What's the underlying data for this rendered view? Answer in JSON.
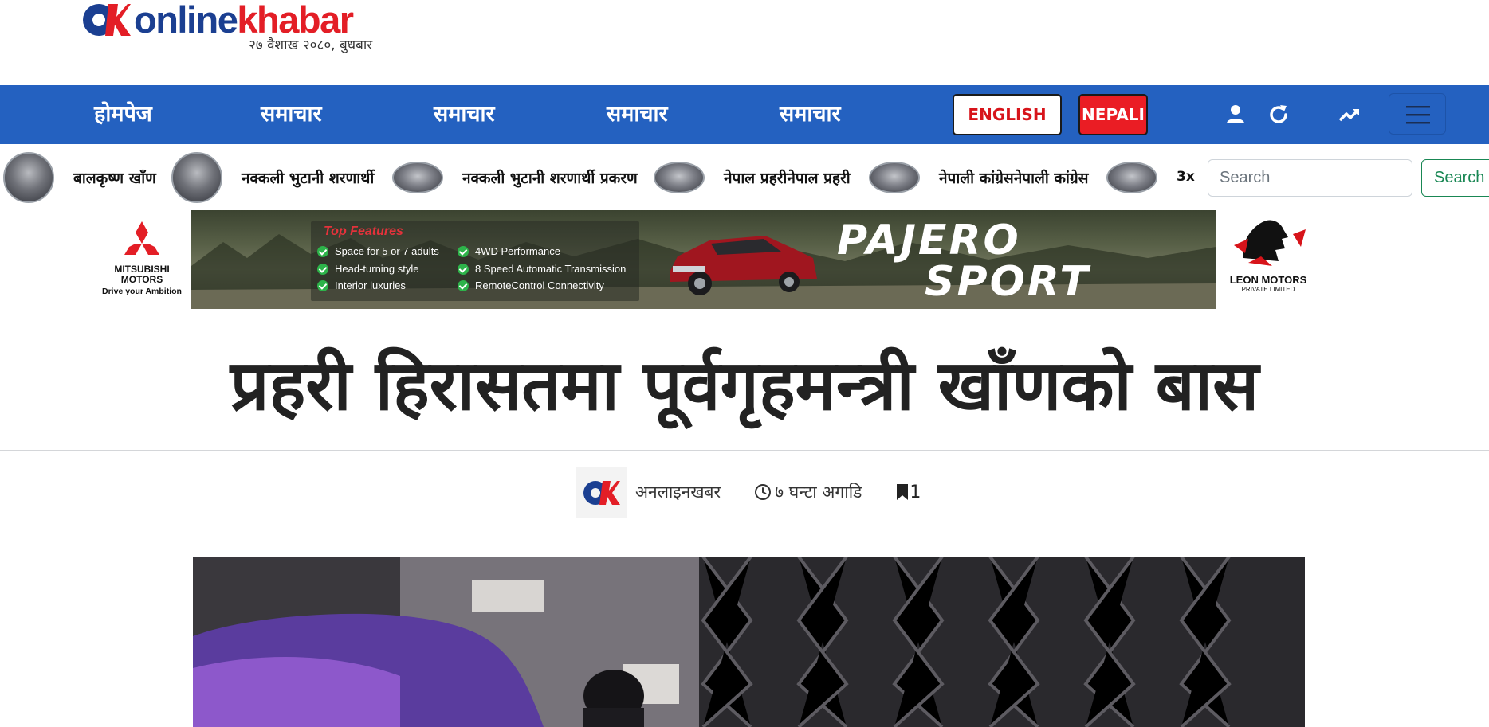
{
  "header": {
    "logo_part1": "online",
    "logo_part2": "khabar",
    "date": "२७ वैशाख २०८०, बुधबार"
  },
  "nav": {
    "items": [
      {
        "label": "होमपेज"
      },
      {
        "label": "समाचार"
      },
      {
        "label": "समाचार"
      },
      {
        "label": "समाचार"
      },
      {
        "label": "समाचार"
      }
    ],
    "english_label": "ENGLISH",
    "nepali_label": "NEPALI",
    "icons": [
      "user-icon",
      "refresh-icon",
      "trending-icon",
      "menu-icon"
    ]
  },
  "trending": {
    "items": [
      {
        "label": "बालकृष्ण खाँण"
      },
      {
        "label": "नक्कली भुटानी शरणार्थी"
      },
      {
        "label": "नक्कली भुटानी शरणार्थी प्रकरण"
      },
      {
        "label": "नेपाल प्रहरीनेपाल प्रहरी"
      },
      {
        "label": "नेपाली कांग्रेसनेपाली कांग्रेस"
      }
    ],
    "speed": "3x",
    "search_placeholder": "Search",
    "search_button": "Search"
  },
  "ad": {
    "left_brand_line1": "MITSUBISHI",
    "left_brand_line2": "MOTORS",
    "left_tagline": "Drive your Ambition",
    "features_title": "Top Features",
    "features": [
      "Space for 5 or 7 adults",
      "Head-turning style",
      "Interior luxuries",
      "4WD Performance",
      "8 Speed Automatic Transmission",
      "RemoteControl Connectivity"
    ],
    "brand_line1": "PAJERO",
    "brand_line2": "SPORT",
    "right_brand": "LEON MOTORS",
    "right_sub": "PRIVATE LIMITED"
  },
  "article": {
    "headline": "प्रहरी हिरासतमा पूर्वगृहमन्त्री खाँणको बास",
    "author": "अनलाइनखबर",
    "time": "७ घन्टा अगाडि",
    "bookmark_count": "1"
  },
  "colors": {
    "nav_blue": "#2461c0",
    "brand_red": "#e31e26",
    "brand_blue": "#1b3f91",
    "search_green": "#198754"
  }
}
